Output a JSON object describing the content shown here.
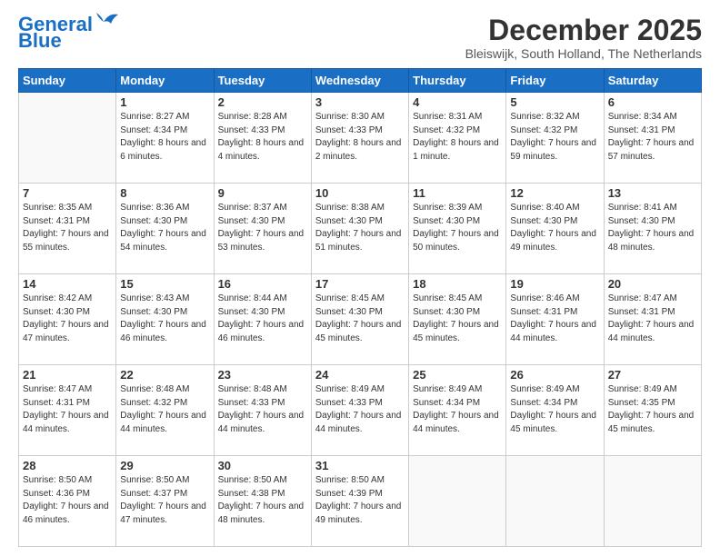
{
  "header": {
    "logo_line1": "General",
    "logo_line2": "Blue",
    "month_title": "December 2025",
    "location": "Bleiswijk, South Holland, The Netherlands"
  },
  "days_of_week": [
    "Sunday",
    "Monday",
    "Tuesday",
    "Wednesday",
    "Thursday",
    "Friday",
    "Saturday"
  ],
  "weeks": [
    [
      {
        "day": "",
        "sunrise": "",
        "sunset": "",
        "daylight": ""
      },
      {
        "day": "1",
        "sunrise": "Sunrise: 8:27 AM",
        "sunset": "Sunset: 4:34 PM",
        "daylight": "Daylight: 8 hours and 6 minutes."
      },
      {
        "day": "2",
        "sunrise": "Sunrise: 8:28 AM",
        "sunset": "Sunset: 4:33 PM",
        "daylight": "Daylight: 8 hours and 4 minutes."
      },
      {
        "day": "3",
        "sunrise": "Sunrise: 8:30 AM",
        "sunset": "Sunset: 4:33 PM",
        "daylight": "Daylight: 8 hours and 2 minutes."
      },
      {
        "day": "4",
        "sunrise": "Sunrise: 8:31 AM",
        "sunset": "Sunset: 4:32 PM",
        "daylight": "Daylight: 8 hours and 1 minute."
      },
      {
        "day": "5",
        "sunrise": "Sunrise: 8:32 AM",
        "sunset": "Sunset: 4:32 PM",
        "daylight": "Daylight: 7 hours and 59 minutes."
      },
      {
        "day": "6",
        "sunrise": "Sunrise: 8:34 AM",
        "sunset": "Sunset: 4:31 PM",
        "daylight": "Daylight: 7 hours and 57 minutes."
      }
    ],
    [
      {
        "day": "7",
        "sunrise": "Sunrise: 8:35 AM",
        "sunset": "Sunset: 4:31 PM",
        "daylight": "Daylight: 7 hours and 55 minutes."
      },
      {
        "day": "8",
        "sunrise": "Sunrise: 8:36 AM",
        "sunset": "Sunset: 4:30 PM",
        "daylight": "Daylight: 7 hours and 54 minutes."
      },
      {
        "day": "9",
        "sunrise": "Sunrise: 8:37 AM",
        "sunset": "Sunset: 4:30 PM",
        "daylight": "Daylight: 7 hours and 53 minutes."
      },
      {
        "day": "10",
        "sunrise": "Sunrise: 8:38 AM",
        "sunset": "Sunset: 4:30 PM",
        "daylight": "Daylight: 7 hours and 51 minutes."
      },
      {
        "day": "11",
        "sunrise": "Sunrise: 8:39 AM",
        "sunset": "Sunset: 4:30 PM",
        "daylight": "Daylight: 7 hours and 50 minutes."
      },
      {
        "day": "12",
        "sunrise": "Sunrise: 8:40 AM",
        "sunset": "Sunset: 4:30 PM",
        "daylight": "Daylight: 7 hours and 49 minutes."
      },
      {
        "day": "13",
        "sunrise": "Sunrise: 8:41 AM",
        "sunset": "Sunset: 4:30 PM",
        "daylight": "Daylight: 7 hours and 48 minutes."
      }
    ],
    [
      {
        "day": "14",
        "sunrise": "Sunrise: 8:42 AM",
        "sunset": "Sunset: 4:30 PM",
        "daylight": "Daylight: 7 hours and 47 minutes."
      },
      {
        "day": "15",
        "sunrise": "Sunrise: 8:43 AM",
        "sunset": "Sunset: 4:30 PM",
        "daylight": "Daylight: 7 hours and 46 minutes."
      },
      {
        "day": "16",
        "sunrise": "Sunrise: 8:44 AM",
        "sunset": "Sunset: 4:30 PM",
        "daylight": "Daylight: 7 hours and 46 minutes."
      },
      {
        "day": "17",
        "sunrise": "Sunrise: 8:45 AM",
        "sunset": "Sunset: 4:30 PM",
        "daylight": "Daylight: 7 hours and 45 minutes."
      },
      {
        "day": "18",
        "sunrise": "Sunrise: 8:45 AM",
        "sunset": "Sunset: 4:30 PM",
        "daylight": "Daylight: 7 hours and 45 minutes."
      },
      {
        "day": "19",
        "sunrise": "Sunrise: 8:46 AM",
        "sunset": "Sunset: 4:31 PM",
        "daylight": "Daylight: 7 hours and 44 minutes."
      },
      {
        "day": "20",
        "sunrise": "Sunrise: 8:47 AM",
        "sunset": "Sunset: 4:31 PM",
        "daylight": "Daylight: 7 hours and 44 minutes."
      }
    ],
    [
      {
        "day": "21",
        "sunrise": "Sunrise: 8:47 AM",
        "sunset": "Sunset: 4:31 PM",
        "daylight": "Daylight: 7 hours and 44 minutes."
      },
      {
        "day": "22",
        "sunrise": "Sunrise: 8:48 AM",
        "sunset": "Sunset: 4:32 PM",
        "daylight": "Daylight: 7 hours and 44 minutes."
      },
      {
        "day": "23",
        "sunrise": "Sunrise: 8:48 AM",
        "sunset": "Sunset: 4:33 PM",
        "daylight": "Daylight: 7 hours and 44 minutes."
      },
      {
        "day": "24",
        "sunrise": "Sunrise: 8:49 AM",
        "sunset": "Sunset: 4:33 PM",
        "daylight": "Daylight: 7 hours and 44 minutes."
      },
      {
        "day": "25",
        "sunrise": "Sunrise: 8:49 AM",
        "sunset": "Sunset: 4:34 PM",
        "daylight": "Daylight: 7 hours and 44 minutes."
      },
      {
        "day": "26",
        "sunrise": "Sunrise: 8:49 AM",
        "sunset": "Sunset: 4:34 PM",
        "daylight": "Daylight: 7 hours and 45 minutes."
      },
      {
        "day": "27",
        "sunrise": "Sunrise: 8:49 AM",
        "sunset": "Sunset: 4:35 PM",
        "daylight": "Daylight: 7 hours and 45 minutes."
      }
    ],
    [
      {
        "day": "28",
        "sunrise": "Sunrise: 8:50 AM",
        "sunset": "Sunset: 4:36 PM",
        "daylight": "Daylight: 7 hours and 46 minutes."
      },
      {
        "day": "29",
        "sunrise": "Sunrise: 8:50 AM",
        "sunset": "Sunset: 4:37 PM",
        "daylight": "Daylight: 7 hours and 47 minutes."
      },
      {
        "day": "30",
        "sunrise": "Sunrise: 8:50 AM",
        "sunset": "Sunset: 4:38 PM",
        "daylight": "Daylight: 7 hours and 48 minutes."
      },
      {
        "day": "31",
        "sunrise": "Sunrise: 8:50 AM",
        "sunset": "Sunset: 4:39 PM",
        "daylight": "Daylight: 7 hours and 49 minutes."
      },
      {
        "day": "",
        "sunrise": "",
        "sunset": "",
        "daylight": ""
      },
      {
        "day": "",
        "sunrise": "",
        "sunset": "",
        "daylight": ""
      },
      {
        "day": "",
        "sunrise": "",
        "sunset": "",
        "daylight": ""
      }
    ]
  ]
}
